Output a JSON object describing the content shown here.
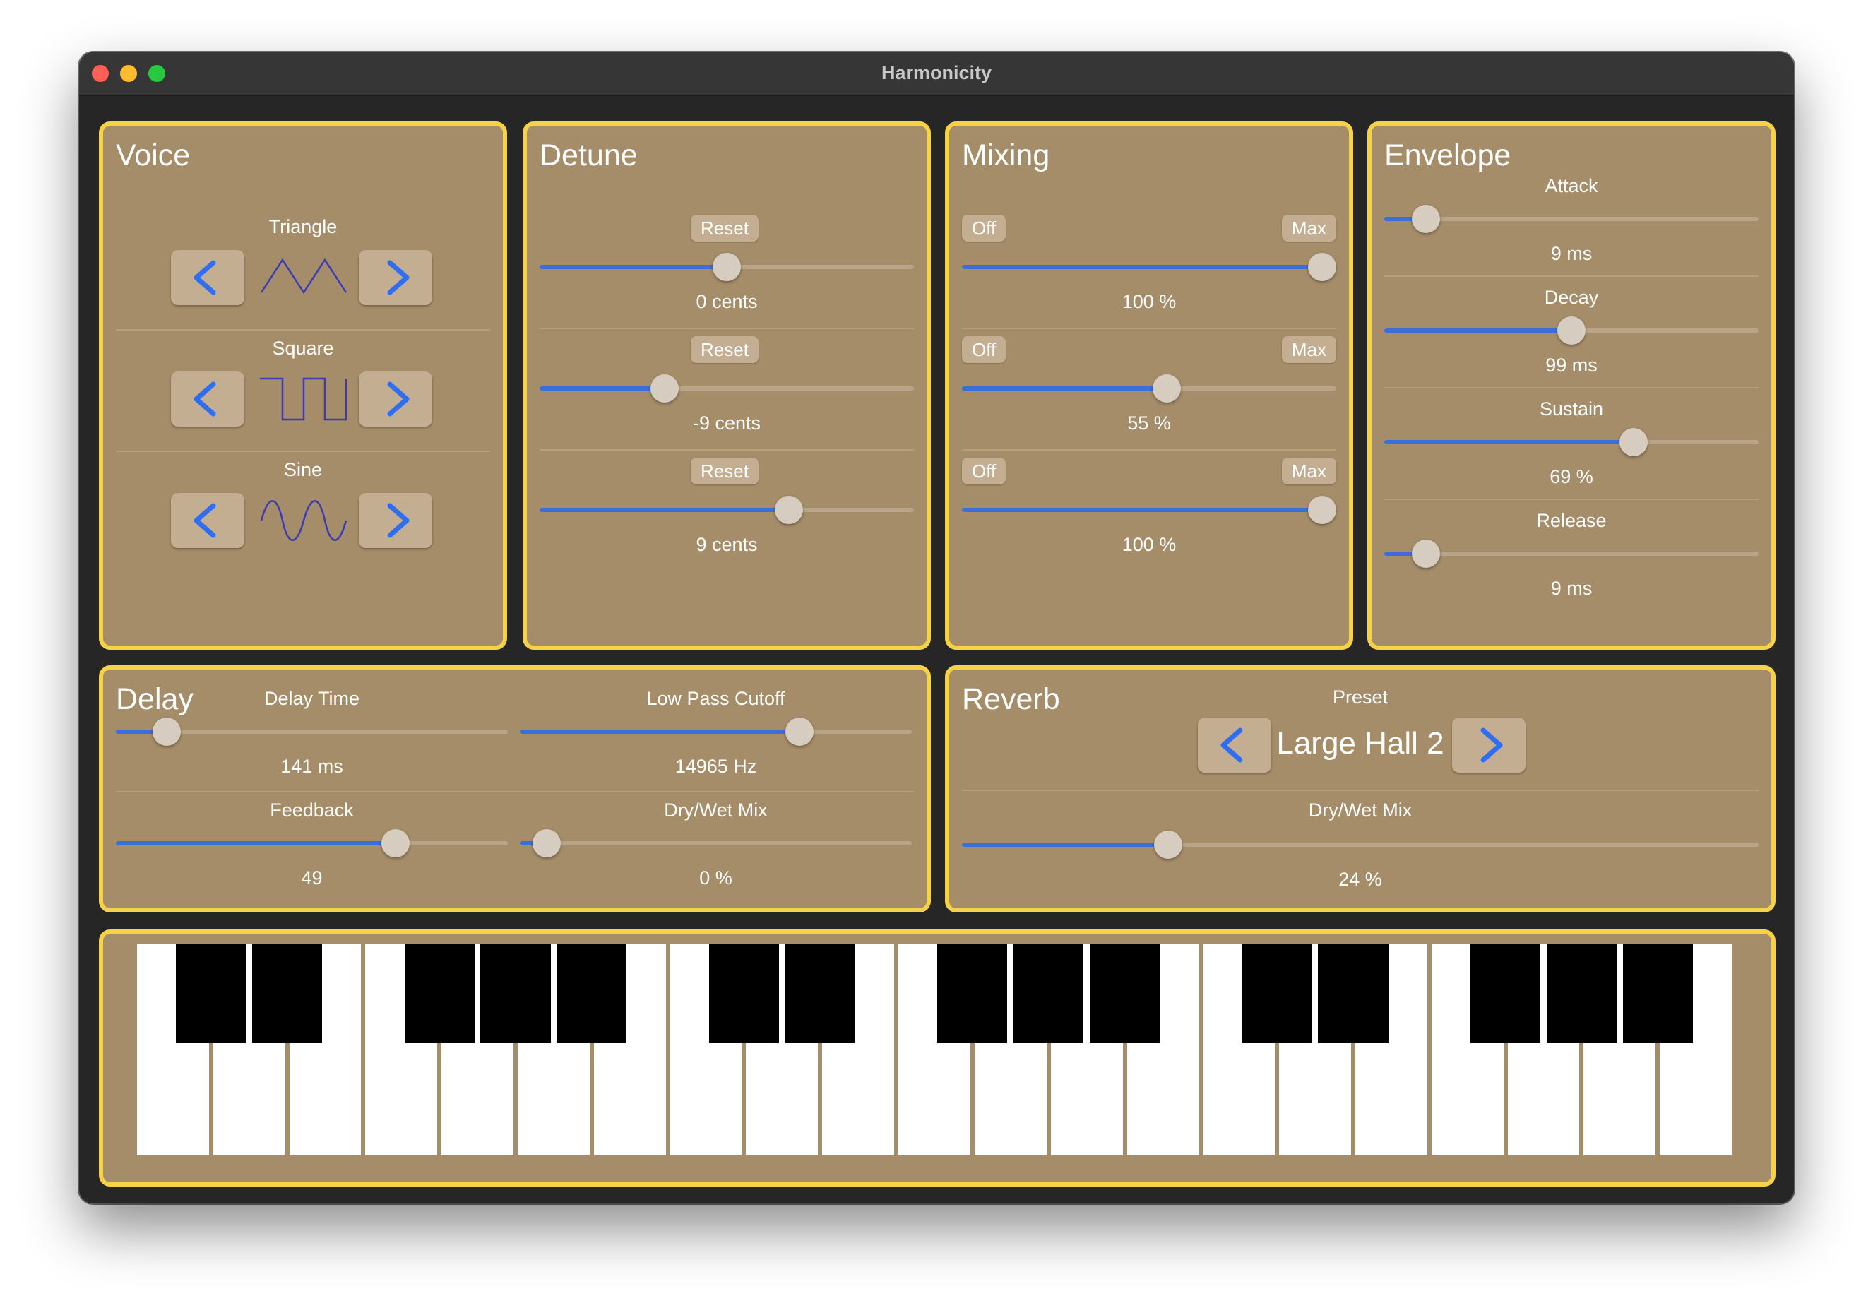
{
  "window": {
    "title": "Harmonicity"
  },
  "colors": {
    "panel": "#a68d69",
    "panel_border": "#f6d247",
    "slider_fill": "#3a6fd8",
    "arrow": "#2f6ef0"
  },
  "voice": {
    "title": "Voice",
    "rows": [
      {
        "label": "Triangle",
        "icon": "triangle-wave-icon"
      },
      {
        "label": "Square",
        "icon": "square-wave-icon"
      },
      {
        "label": "Sine",
        "icon": "sine-wave-icon"
      }
    ]
  },
  "detune": {
    "title": "Detune",
    "reset_label": "Reset",
    "rows": [
      {
        "value_text": "0 cents",
        "position": 0.5
      },
      {
        "value_text": "-9 cents",
        "position": 0.32
      },
      {
        "value_text": "9 cents",
        "position": 0.68
      }
    ]
  },
  "mixing": {
    "title": "Mixing",
    "off_label": "Off",
    "max_label": "Max",
    "rows": [
      {
        "value_text": "100 %",
        "level": 1.0
      },
      {
        "value_text": "55 %",
        "level": 0.55
      },
      {
        "value_text": "100 %",
        "level": 1.0
      }
    ]
  },
  "envelope": {
    "title": "Envelope",
    "rows": [
      {
        "label": "Attack",
        "value_text": "9 ms",
        "position": 0.08
      },
      {
        "label": "Decay",
        "value_text": "99 ms",
        "position": 0.5
      },
      {
        "label": "Sustain",
        "value_text": "69 %",
        "position": 0.68
      },
      {
        "label": "Release",
        "value_text": "9 ms",
        "position": 0.08
      }
    ]
  },
  "delay": {
    "title": "Delay",
    "controls": [
      {
        "label": "Delay Time",
        "value_text": "141 ms",
        "position": 0.1
      },
      {
        "label": "Low Pass Cutoff",
        "value_text": "14965 Hz",
        "position": 0.73
      },
      {
        "label": "Feedback",
        "value_text": "49",
        "position": 0.73
      },
      {
        "label": "Dry/Wet Mix",
        "value_text": "0 %",
        "position": 0.035
      }
    ]
  },
  "reverb": {
    "title": "Reverb",
    "preset_label": "Preset",
    "preset_name": "Large Hall 2",
    "mix_label": "Dry/Wet Mix",
    "mix_value_text": "24 %",
    "mix_position": 0.25
  },
  "keyboard": {
    "white_keys": 21
  }
}
